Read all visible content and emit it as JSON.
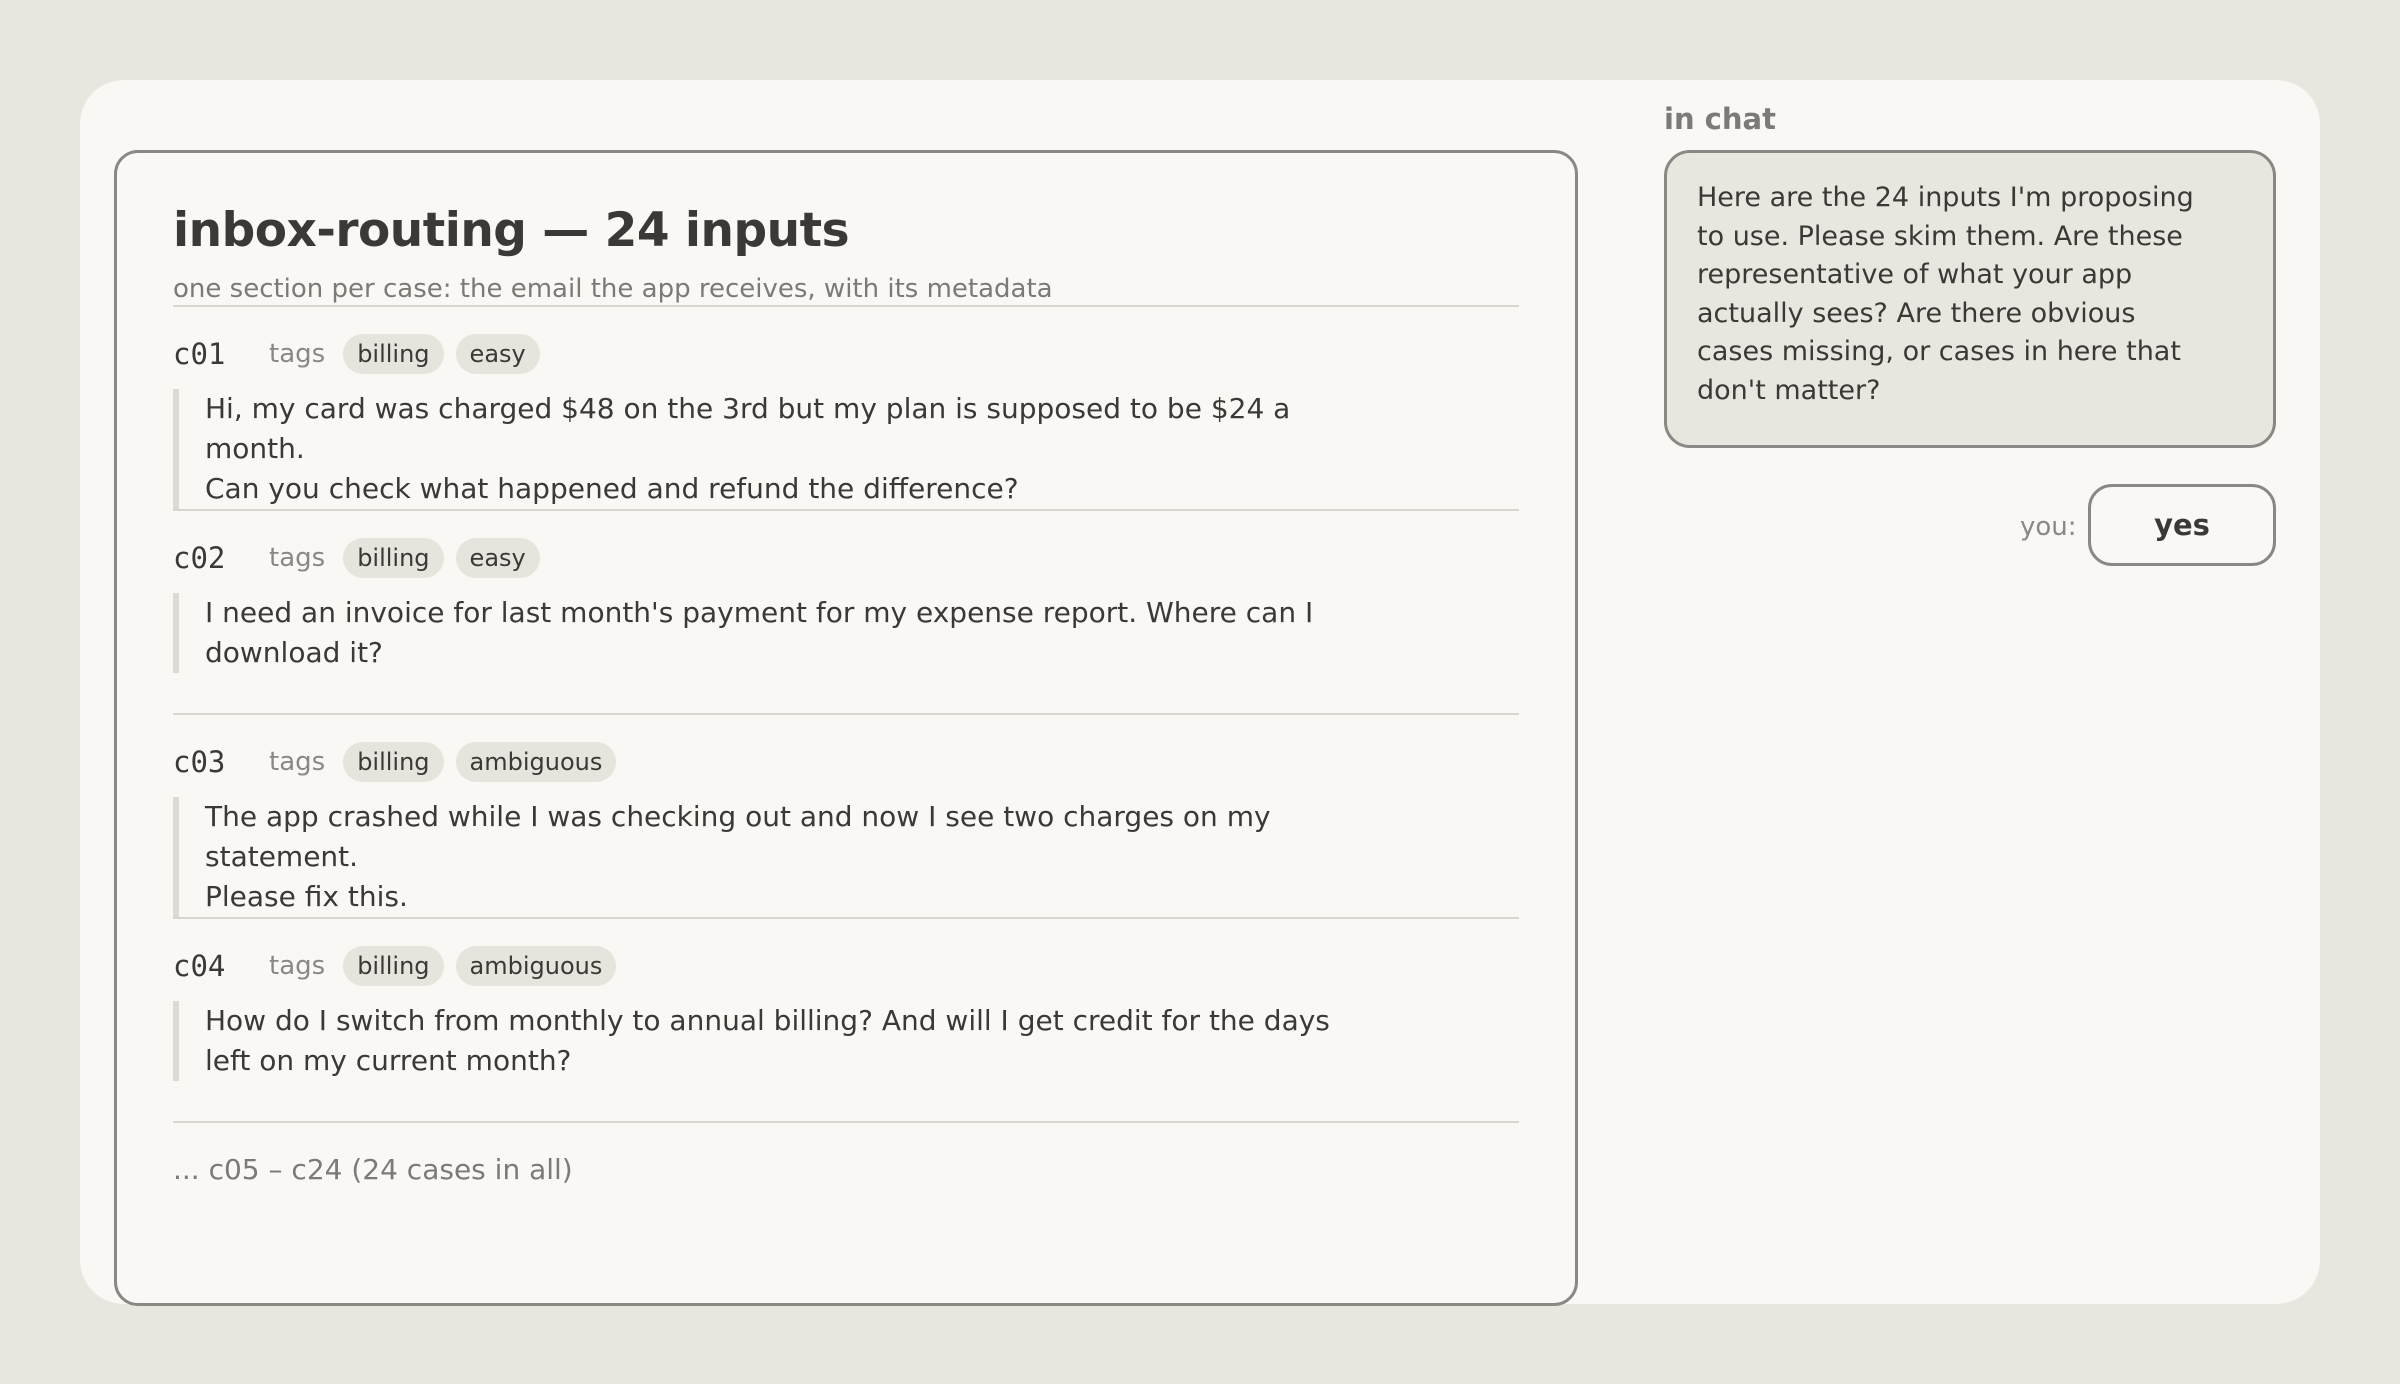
{
  "doc": {
    "title": "inbox-routing — 24 inputs",
    "subtitle": "one section per case: the email the app receives, with its metadata",
    "tags_label": "tags",
    "cases": [
      {
        "id": "c01",
        "tags": [
          "billing",
          "easy"
        ],
        "lines": [
          "Hi, my card was charged $48 on the 3rd but my plan is supposed to be $24 a month.",
          "Can you check what happened and refund the difference?"
        ]
      },
      {
        "id": "c02",
        "tags": [
          "billing",
          "easy"
        ],
        "lines": [
          "I need an invoice for last month's payment for my expense report. Where can I",
          "download it?"
        ]
      },
      {
        "id": "c03",
        "tags": [
          "billing",
          "ambiguous"
        ],
        "lines": [
          "The app crashed while I was checking out and now I see two charges on my statement.",
          "Please fix this."
        ]
      },
      {
        "id": "c04",
        "tags": [
          "billing",
          "ambiguous"
        ],
        "lines": [
          "How do I switch from monthly to annual billing? And will I get credit for the days",
          "left on my current month?"
        ]
      }
    ],
    "more": "... c05 – c24 (24 cases in all)"
  },
  "chat": {
    "label": "in chat",
    "message_lines": [
      "Here are the 24 inputs I'm proposing",
      "to use. Please skim them. Are these",
      "representative of what your app",
      "actually sees? Are there obvious",
      "cases missing, or cases in here that",
      "don't matter?"
    ],
    "you_label": "you:",
    "reply": "yes"
  }
}
